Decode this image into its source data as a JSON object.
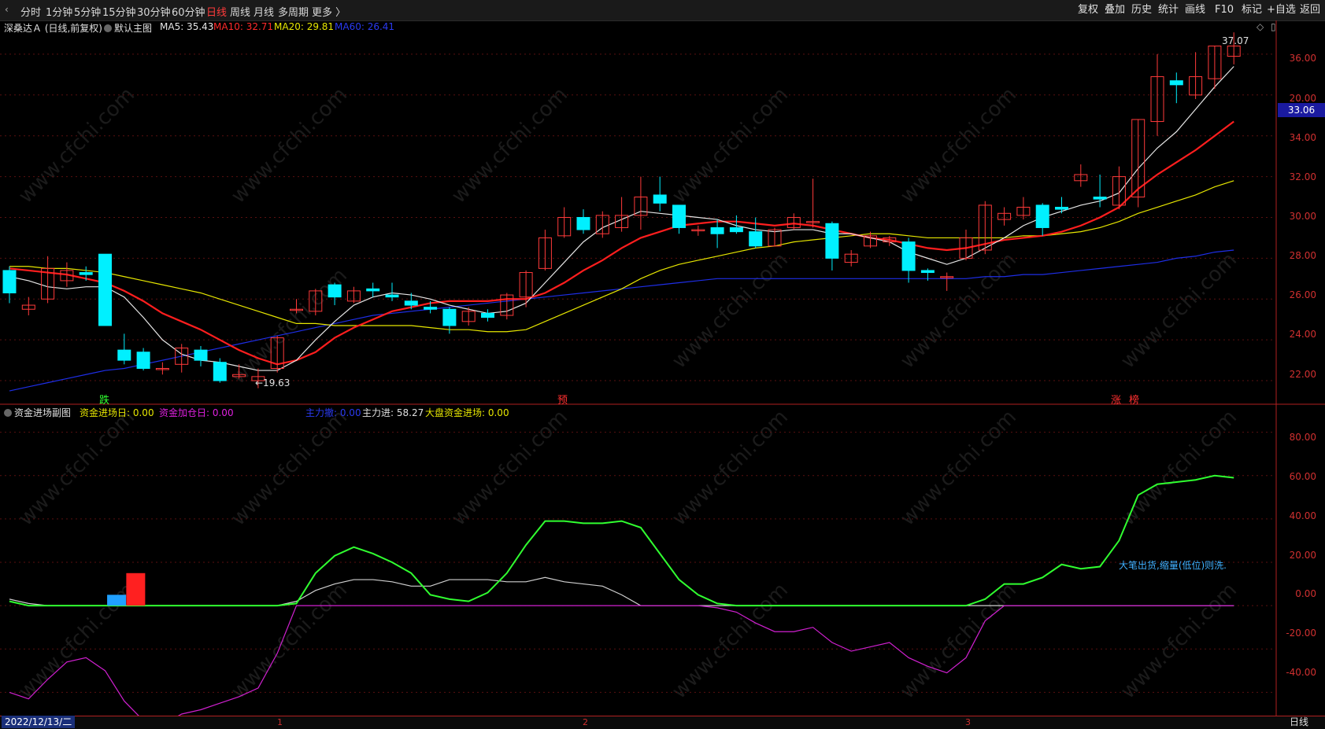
{
  "toolbar": {
    "periods": [
      "分时",
      "1分钟",
      "5分钟",
      "15分钟",
      "30分钟",
      "60分钟",
      "日线",
      "周线",
      "月线",
      "多周期",
      "更多 〉"
    ],
    "active_period": "日线",
    "actions": [
      "复权",
      "叠加",
      "历史",
      "统计",
      "画线",
      "F10",
      "标记",
      "+自选",
      "返回"
    ]
  },
  "main_chart": {
    "stock_name": "深桑达Ａ (日线,前复权)",
    "template": "默认主图",
    "ma5_label": "MA5: 35.43",
    "ma10_label": "MA10: 32.71",
    "ma20_label": "MA20: 29.81",
    "ma60_label": "MA60: 26.41",
    "high_marker": "37.07",
    "low_marker": "←19.63",
    "current_price": "33.06",
    "y_ticks": [
      "36.00",
      "34.00",
      "32.00",
      "30.00",
      "28.00",
      "26.00",
      "24.00",
      "22.00",
      "20.00"
    ],
    "signals": [
      {
        "text": "跌",
        "color": "#30ff30"
      },
      {
        "text": "预",
        "color": "#ff3030"
      },
      {
        "text": "涨",
        "color": "#ff3030"
      },
      {
        "text": "榜",
        "color": "#ff3030"
      }
    ],
    "colors": {
      "up": "#ff3a3a",
      "down": "#00f0ff",
      "ma5": "#e6e6e6",
      "ma10": "#ff1e1e",
      "ma20": "#e6e600",
      "ma60": "#1e2ee6"
    }
  },
  "sub_chart": {
    "title": "资金进场副图",
    "entry_label": "资金进场日: 0.00",
    "add_label": "资金加仓日: 0.00",
    "main_out_label": "主力撤: 0.00",
    "main_in_label": "主力进: 58.27",
    "market_label": "大盘资金进场: 0.00",
    "note": "大笔出货,缩量(低位)则洗.",
    "y_ticks": [
      "80.00",
      "60.00",
      "40.00",
      "20.00",
      "0.00",
      "-20.00",
      "-40.00"
    ],
    "colors": {
      "green": "#30ff30",
      "white": "#cfcfcf",
      "magenta": "#d020d0"
    }
  },
  "chart_data": {
    "type": "candlestick",
    "price_range": [
      19,
      37.5
    ],
    "candles": [
      [
        25.4,
        24.3,
        25.6,
        23.8
      ],
      [
        23.5,
        23.7,
        24.1,
        23.2
      ],
      [
        24.0,
        25.5,
        26.1,
        23.8
      ],
      [
        24.9,
        25.4,
        25.8,
        24.6
      ],
      [
        25.3,
        25.2,
        25.6,
        24.9
      ],
      [
        26.2,
        22.7,
        26.2,
        22.7
      ],
      [
        21.5,
        21.0,
        22.3,
        20.8
      ],
      [
        21.4,
        20.6,
        21.6,
        20.5
      ],
      [
        20.6,
        20.6,
        20.9,
        20.3
      ],
      [
        20.8,
        21.6,
        21.8,
        20.4
      ],
      [
        21.5,
        21.0,
        21.7,
        20.7
      ],
      [
        20.9,
        20.0,
        21.1,
        19.9
      ],
      [
        20.2,
        20.3,
        20.8,
        20.1
      ],
      [
        20.0,
        20.2,
        20.6,
        19.63
      ],
      [
        20.6,
        22.1,
        22.2,
        20.4
      ],
      [
        23.5,
        23.5,
        24.0,
        23.3
      ],
      [
        23.4,
        24.4,
        24.5,
        23.2
      ],
      [
        24.7,
        24.1,
        24.8,
        23.7
      ],
      [
        23.9,
        24.4,
        24.6,
        23.8
      ],
      [
        24.5,
        24.4,
        24.8,
        24.1
      ],
      [
        24.2,
        24.1,
        24.8,
        23.9
      ],
      [
        23.9,
        23.7,
        24.3,
        23.5
      ],
      [
        23.6,
        23.5,
        23.9,
        23.3
      ],
      [
        23.5,
        22.7,
        23.6,
        22.3
      ],
      [
        22.9,
        23.4,
        23.6,
        22.7
      ],
      [
        23.3,
        23.1,
        23.5,
        22.9
      ],
      [
        23.2,
        24.2,
        24.3,
        23.0
      ],
      [
        24.1,
        25.3,
        25.4,
        23.6
      ],
      [
        25.5,
        27.0,
        27.4,
        25.4
      ],
      [
        27.1,
        28.0,
        28.5,
        27.0
      ],
      [
        28.0,
        27.4,
        28.4,
        27.2
      ],
      [
        27.2,
        28.1,
        28.3,
        27.0
      ],
      [
        27.5,
        28.1,
        29.0,
        27.3
      ],
      [
        28.1,
        29.0,
        30.0,
        27.4
      ],
      [
        29.1,
        28.7,
        30.0,
        28.3
      ],
      [
        28.6,
        27.5,
        28.6,
        27.2
      ],
      [
        27.4,
        27.4,
        27.6,
        27.1
      ],
      [
        27.5,
        27.2,
        27.9,
        26.5
      ],
      [
        27.5,
        27.3,
        28.1,
        27.2
      ],
      [
        27.3,
        26.6,
        28.0,
        26.5
      ],
      [
        26.6,
        27.4,
        27.5,
        26.6
      ],
      [
        27.5,
        28.0,
        28.2,
        27.4
      ],
      [
        27.8,
        27.8,
        29.9,
        27.5
      ],
      [
        27.7,
        26.0,
        27.8,
        25.4
      ],
      [
        25.8,
        26.2,
        26.4,
        25.6
      ],
      [
        26.6,
        27.1,
        27.3,
        26.5
      ],
      [
        26.8,
        27.0,
        27.1,
        26.6
      ],
      [
        26.8,
        25.4,
        27.0,
        24.8
      ],
      [
        25.4,
        25.3,
        25.5,
        24.9
      ],
      [
        25.1,
        25.1,
        25.3,
        24.4
      ],
      [
        26.0,
        27.0,
        27.4,
        25.9
      ],
      [
        26.4,
        28.6,
        28.8,
        26.2
      ],
      [
        27.9,
        28.2,
        28.5,
        27.6
      ],
      [
        28.1,
        28.5,
        29.0,
        27.9
      ],
      [
        28.6,
        27.5,
        28.7,
        27.1
      ],
      [
        28.5,
        28.4,
        29.0,
        28.2
      ],
      [
        29.8,
        30.1,
        30.6,
        29.5
      ],
      [
        29.0,
        28.9,
        30.1,
        28.5
      ],
      [
        28.6,
        30.0,
        30.5,
        28.4
      ],
      [
        29.0,
        32.8,
        32.8,
        28.5
      ],
      [
        32.7,
        34.9,
        36.0,
        32.0
      ],
      [
        34.7,
        34.5,
        35.1,
        33.6
      ],
      [
        34.0,
        34.9,
        36.1,
        33.8
      ],
      [
        34.8,
        36.4,
        36.4,
        34.3
      ],
      [
        35.9,
        36.4,
        37.07,
        35.5
      ]
    ],
    "ma5": [
      25.1,
      24.9,
      24.6,
      24.5,
      24.6,
      24.6,
      24.1,
      23.1,
      22.0,
      21.3,
      21.0,
      20.9,
      20.7,
      20.5,
      20.5,
      21.0,
      22.0,
      22.9,
      23.7,
      24.1,
      24.3,
      24.2,
      24.0,
      23.7,
      23.5,
      23.3,
      23.4,
      23.8,
      24.8,
      25.8,
      26.8,
      27.5,
      27.9,
      28.3,
      28.2,
      28.1,
      28.0,
      27.9,
      27.6,
      27.4,
      27.3,
      27.4,
      27.4,
      27.2,
      27.2,
      27.0,
      26.8,
      26.3,
      26.0,
      25.7,
      26.0,
      26.5,
      27.0,
      27.6,
      28.0,
      28.3,
      28.6,
      28.8,
      29.2,
      30.4,
      31.4,
      32.2,
      33.3,
      34.4,
      35.4
    ],
    "ma10": [
      25.5,
      25.4,
      25.3,
      25.2,
      25.0,
      24.8,
      24.4,
      23.9,
      23.3,
      22.9,
      22.5,
      22.0,
      21.5,
      21.1,
      20.8,
      21.0,
      21.4,
      22.1,
      22.6,
      23.0,
      23.4,
      23.6,
      23.8,
      23.9,
      23.9,
      23.9,
      24.0,
      24.0,
      24.3,
      24.8,
      25.4,
      25.9,
      26.5,
      27.0,
      27.3,
      27.6,
      27.7,
      27.8,
      27.8,
      27.7,
      27.6,
      27.7,
      27.6,
      27.4,
      27.2,
      27.0,
      26.9,
      26.7,
      26.5,
      26.4,
      26.5,
      26.7,
      26.9,
      27.0,
      27.1,
      27.3,
      27.6,
      28.0,
      28.5,
      29.4,
      30.1,
      30.7,
      31.3,
      32.0,
      32.7
    ],
    "ma20": [
      25.6,
      25.6,
      25.5,
      25.5,
      25.4,
      25.3,
      25.1,
      24.9,
      24.7,
      24.5,
      24.3,
      24.0,
      23.7,
      23.4,
      23.1,
      22.8,
      22.8,
      22.7,
      22.7,
      22.7,
      22.7,
      22.7,
      22.6,
      22.5,
      22.5,
      22.4,
      22.4,
      22.5,
      22.9,
      23.3,
      23.7,
      24.1,
      24.5,
      25.0,
      25.4,
      25.7,
      25.9,
      26.1,
      26.3,
      26.5,
      26.6,
      26.8,
      26.9,
      27.0,
      27.1,
      27.2,
      27.2,
      27.1,
      27.0,
      27.0,
      27.0,
      27.0,
      27.0,
      27.1,
      27.1,
      27.2,
      27.3,
      27.5,
      27.8,
      28.2,
      28.5,
      28.8,
      29.1,
      29.5,
      29.8
    ],
    "ma60": [
      19.5,
      19.7,
      19.9,
      20.1,
      20.3,
      20.5,
      20.6,
      20.8,
      21.0,
      21.2,
      21.4,
      21.6,
      21.8,
      22.0,
      22.2,
      22.4,
      22.6,
      22.8,
      23.0,
      23.2,
      23.3,
      23.4,
      23.5,
      23.6,
      23.7,
      23.8,
      23.9,
      24.0,
      24.1,
      24.2,
      24.3,
      24.4,
      24.5,
      24.6,
      24.7,
      24.8,
      24.9,
      25.0,
      25.0,
      25.0,
      25.0,
      25.0,
      25.0,
      25.0,
      25.0,
      25.0,
      25.0,
      25.0,
      25.0,
      25.0,
      25.0,
      25.1,
      25.1,
      25.2,
      25.2,
      25.3,
      25.4,
      25.5,
      25.6,
      25.7,
      25.8,
      26.0,
      26.1,
      26.3,
      26.4
    ],
    "sub_range": [
      -50,
      90
    ],
    "sub_green": [
      2,
      0,
      0,
      0,
      0,
      0,
      0,
      0,
      0,
      0,
      0,
      0,
      0,
      0,
      0,
      1,
      15,
      23,
      27,
      24,
      20,
      15,
      5,
      3,
      2,
      6,
      15,
      28,
      39,
      39,
      38,
      38,
      39,
      36,
      24,
      12,
      5,
      1,
      0,
      0,
      0,
      0,
      0,
      0,
      0,
      0,
      0,
      0,
      0,
      0,
      0,
      3,
      10,
      10,
      13,
      19,
      17,
      18,
      30,
      51,
      56,
      57,
      58,
      60,
      59
    ],
    "sub_white": [
      3,
      1,
      0,
      0,
      0,
      0,
      0,
      0,
      0,
      0,
      0,
      0,
      0,
      0,
      0,
      2,
      7,
      10,
      12,
      12,
      11,
      9,
      9,
      12,
      12,
      12,
      11,
      11,
      13,
      11,
      10,
      9,
      5,
      0,
      0,
      0,
      0,
      0,
      0,
      0,
      0,
      0,
      0,
      0,
      0,
      0,
      0,
      0,
      0,
      0,
      0,
      0,
      0,
      0,
      0,
      0,
      0,
      0,
      0,
      0,
      0,
      0,
      0,
      0,
      0
    ],
    "sub_magenta": [
      -40,
      -43,
      -34,
      -26,
      -24,
      -30,
      -44,
      -53,
      -55,
      -50,
      -48,
      -45,
      -42,
      -38,
      -22,
      0,
      0,
      0,
      0,
      0,
      0,
      0,
      0,
      0,
      0,
      0,
      0,
      0,
      0,
      0,
      0,
      0,
      0,
      0,
      0,
      0,
      0,
      -1,
      -3,
      -8,
      -12,
      -12,
      -10,
      -17,
      -21,
      -19,
      -17,
      -24,
      -28,
      -31,
      -24,
      -7,
      0,
      0,
      0,
      0,
      0,
      0,
      0,
      0,
      0,
      0,
      0,
      0,
      0
    ],
    "sub_bars": [
      {
        "index": 5.6,
        "value": 5,
        "color": "#20a0ff"
      },
      {
        "index": 6.6,
        "value": 15,
        "color": "#ff2020"
      }
    ]
  },
  "status": {
    "date": "2022/12/13/二",
    "months": [
      "1",
      "2",
      "3"
    ],
    "mode": "日线"
  }
}
